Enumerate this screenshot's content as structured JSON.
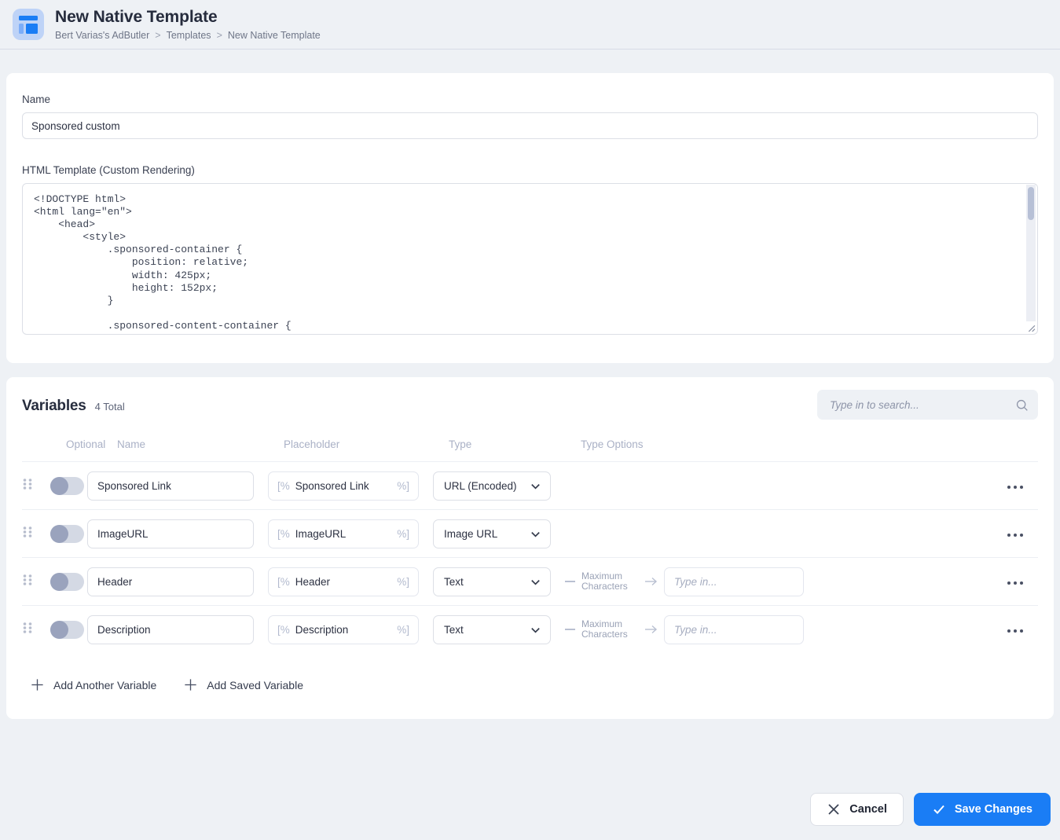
{
  "header": {
    "app_icon": "template-layout-icon",
    "title": "New Native Template",
    "breadcrumb": [
      "Bert Varias's AdButler",
      "Templates",
      "New Native Template"
    ],
    "separator": ">"
  },
  "form": {
    "name_label": "Name",
    "name_value": "Sponsored custom",
    "name_placeholder": "",
    "html_label": "HTML Template (Custom Rendering)",
    "html_code": "<!DOCTYPE html>\n<html lang=\"en\">\n    <head>\n        <style>\n            .sponsored-container {\n                position: relative;\n                width: 425px;\n                height: 152px;\n            }\n\n            .sponsored-content-container {"
  },
  "variables": {
    "title": "Variables",
    "count_label": "4 Total",
    "search_placeholder": "Type in to search...",
    "search_value": "",
    "columns": {
      "optional": "Optional",
      "name": "Name",
      "placeholder": "Placeholder",
      "type": "Type",
      "type_options": "Type Options"
    },
    "rows": [
      {
        "optional": false,
        "name": "Sponsored Link",
        "placeholder_open": "[%",
        "placeholder_name": "Sponsored Link",
        "placeholder_close": "%]",
        "type": "URL (Encoded)",
        "has_options": false,
        "option_label_line1": "",
        "option_label_line2": "",
        "option_value": "",
        "option_placeholder": ""
      },
      {
        "optional": false,
        "name": "ImageURL",
        "placeholder_open": "[%",
        "placeholder_name": "ImageURL",
        "placeholder_close": "%]",
        "type": "Image URL",
        "has_options": false,
        "option_label_line1": "",
        "option_label_line2": "",
        "option_value": "",
        "option_placeholder": ""
      },
      {
        "optional": false,
        "name": "Header",
        "placeholder_open": "[%",
        "placeholder_name": "Header",
        "placeholder_close": "%]",
        "type": "Text",
        "has_options": true,
        "option_label_line1": "Maximum",
        "option_label_line2": "Characters",
        "option_value": "",
        "option_placeholder": "Type in..."
      },
      {
        "optional": false,
        "name": "Description",
        "placeholder_open": "[%",
        "placeholder_name": "Description",
        "placeholder_close": "%]",
        "type": "Text",
        "has_options": true,
        "option_label_line1": "Maximum",
        "option_label_line2": "Characters",
        "option_value": "",
        "option_placeholder": "Type in..."
      }
    ],
    "add_another_label": "Add Another Variable",
    "add_saved_label": "Add Saved Variable"
  },
  "footer": {
    "cancel_label": "Cancel",
    "save_label": "Save Changes",
    "save_color": "#1a7df5"
  }
}
